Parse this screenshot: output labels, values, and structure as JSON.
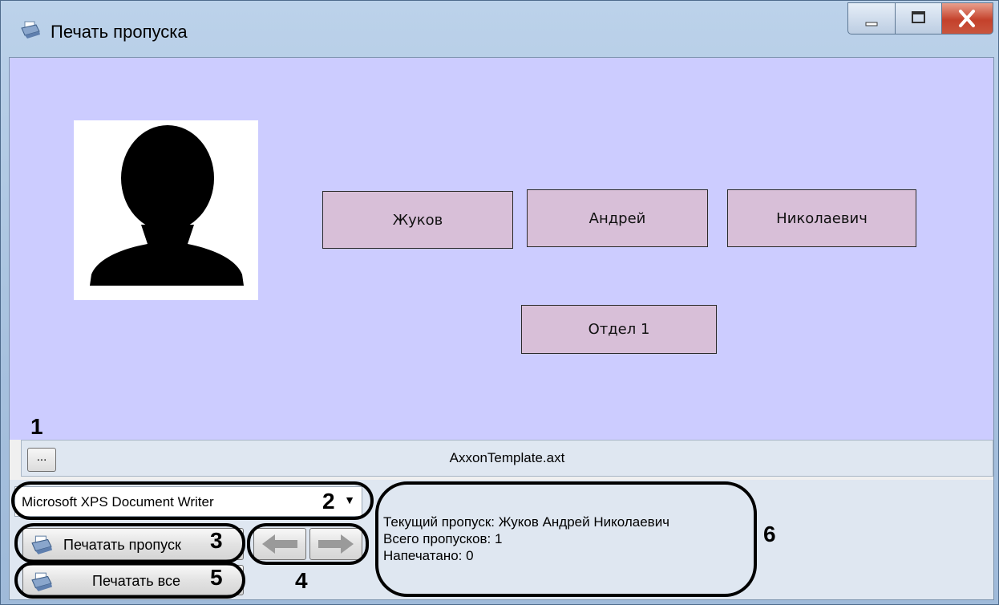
{
  "window": {
    "title": "Печать пропуска",
    "icon": "print-icon",
    "controls": {
      "minimize": "minimize-icon",
      "maximize": "maximize-icon",
      "close": "close-icon"
    }
  },
  "pass_preview": {
    "photo_icon": "person-silhouette-icon",
    "last_name": "Жуков",
    "first_name": "Андрей",
    "middle_name": "Николаевич",
    "department": "Отдел 1",
    "background_color": "#ccccff",
    "field_color": "#d8bfd8"
  },
  "template": {
    "browse_label": "...",
    "file_name": "AxxonTemplate.axt"
  },
  "printer": {
    "selected": "Microsoft XPS Document Writer"
  },
  "actions": {
    "print_pass_label": "Печатать пропуск",
    "print_all_label": "Печатать все",
    "prev_icon": "arrow-left-icon",
    "next_icon": "arrow-right-icon"
  },
  "status": {
    "current_pass": "Текущий пропуск: Жуков Андрей Николаевич",
    "total_passes": "Всего пропусков: 1",
    "printed": "Напечатано: 0"
  },
  "callouts": [
    "1",
    "2",
    "3",
    "4",
    "5",
    "6"
  ]
}
